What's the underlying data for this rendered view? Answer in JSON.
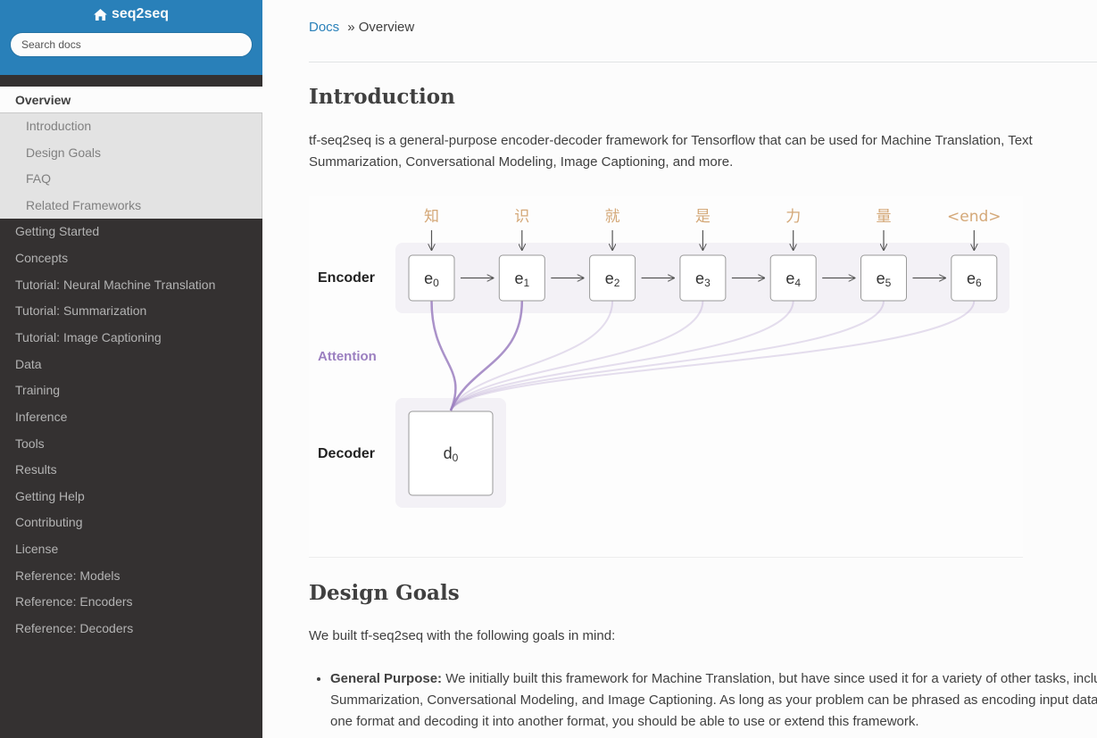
{
  "sidebar": {
    "brand": "seq2seq",
    "brand_icon": "home-icon",
    "search_placeholder": "Search docs",
    "current": "Overview",
    "subitems": [
      "Introduction",
      "Design Goals",
      "FAQ",
      "Related Frameworks"
    ],
    "items": [
      "Getting Started",
      "Concepts",
      "Tutorial: Neural Machine Translation",
      "Tutorial: Summarization",
      "Tutorial: Image Captioning",
      "Data",
      "Training",
      "Inference",
      "Tools",
      "Results",
      "Getting Help",
      "Contributing",
      "License",
      "Reference: Models",
      "Reference: Encoders",
      "Reference: Decoders"
    ]
  },
  "breadcrumb": {
    "root": "Docs",
    "separator": "»",
    "current": "Overview"
  },
  "intro": {
    "title": "Introduction",
    "text": "tf-seq2seq is a general-purpose encoder-decoder framework for Tensorflow that can be used for Machine Translation, Text Summarization, Conversational Modeling, Image Captioning, and more."
  },
  "diagram": {
    "tokens": [
      "知",
      "识",
      "就",
      "是",
      "力",
      "量",
      "<end>"
    ],
    "encoder_label": "Encoder",
    "attention_label": "Attention",
    "decoder_label": "Decoder",
    "encoder_states": [
      "e",
      "e",
      "e",
      "e",
      "e",
      "e",
      "e"
    ],
    "encoder_subscripts": [
      "0",
      "1",
      "2",
      "3",
      "4",
      "5",
      "6"
    ],
    "decoder_state": "d",
    "decoder_subscript": "0",
    "colors": {
      "token": "#d4a878",
      "attention": "#9b7fc0",
      "panel": "#f3f1f6"
    }
  },
  "design_goals": {
    "title": "Design Goals",
    "intro": "We built tf-seq2seq with the following goals in mind:",
    "items": [
      {
        "label": "General Purpose:",
        "text": "We initially built this framework for Machine Translation, but have since used it for a variety of other tasks, including Summarization, Conversational Modeling, and Image Captioning. As long as your problem can be phrased as encoding input data in one format and decoding it into another format, you should be able to use or extend this framework."
      }
    ]
  },
  "colors": {
    "sidebar_bg": "#343131",
    "brand_bg": "#2980b9",
    "link": "#2980b9"
  }
}
